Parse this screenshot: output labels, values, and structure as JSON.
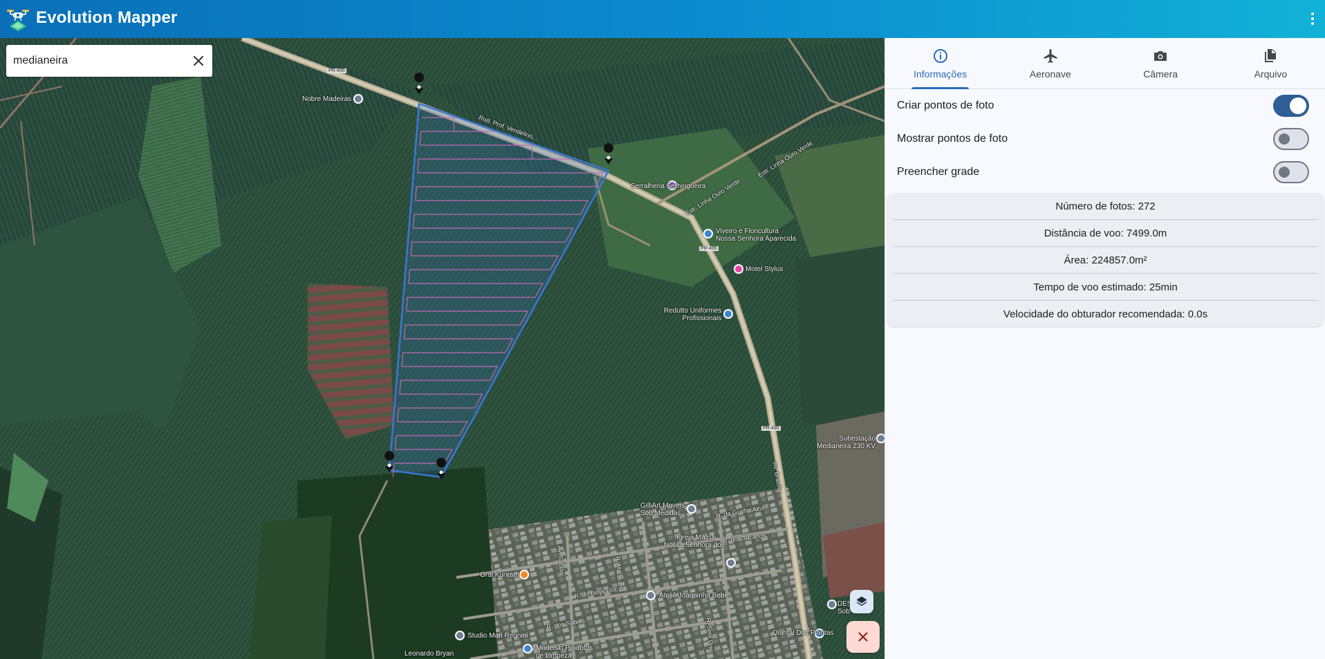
{
  "app": {
    "title": "Evolution Mapper"
  },
  "search": {
    "value": "medianeira",
    "placeholder": ""
  },
  "tabs": [
    {
      "label": "Informações",
      "icon": "info-icon",
      "active": true
    },
    {
      "label": "Aeronave",
      "icon": "airplane-icon",
      "active": false
    },
    {
      "label": "Câmera",
      "icon": "camera-icon",
      "active": false
    },
    {
      "label": "Arquivo",
      "icon": "file-icon",
      "active": false
    }
  ],
  "toggles": [
    {
      "label": "Criar pontos de foto",
      "on": true
    },
    {
      "label": "Mostrar pontos de foto",
      "on": false
    },
    {
      "label": "Preencher grade",
      "on": false
    }
  ],
  "stats": [
    "Número de fotos: 272",
    "Distância de voo: 7499.0m",
    "Área: 224857.0m²",
    "Tempo de voo estimado: 25min",
    "Velocidade do obturador recomendada: 0.0s"
  ],
  "map": {
    "places": [
      "Nobre Madeiras",
      "Serralheria Serhingueira",
      "Viveiro e Floricultura\nNossa Senhora Aparecida",
      "Motel Stylus",
      "Redutto Uniformes\nProfissionais",
      "Subestação\nMedianeira 230 KV",
      "GilliArt Moveis\nSob Medidas",
      "Igreja Matriz\nNossa Senhora do...",
      "Gral Kunrath",
      "Ateliê Joanninha Bebê",
      "DES\nSob",
      "Quintal Das Plantas",
      "Studio Mari Regnini",
      "Modelski Produtos\nde Limpeza",
      "Leonardo Bryan"
    ],
    "roads": [
      "Estr. Linha Ouro Verde",
      "Estr. Linha Ouro Verde",
      "Rod. Prof. Vendelino...",
      "PR-495",
      "PR-495",
      "PR-495",
      "Av. Brasília",
      "R. da Gralha Azul",
      "R. dos Tucanos",
      "R. do Beija-Flor",
      "R. dos Sabiás",
      "Av. Sabiás",
      "R. Maracanã",
      "R. Sete Pres."
    ]
  },
  "colors": {
    "appbar_start": "#0a6fb8",
    "appbar_end": "#12b1d6",
    "accent": "#2d6bb8",
    "switch_on": "#2d5f95",
    "polygon_stroke": "#3a78d6",
    "grid_line": "#c06ab0"
  }
}
